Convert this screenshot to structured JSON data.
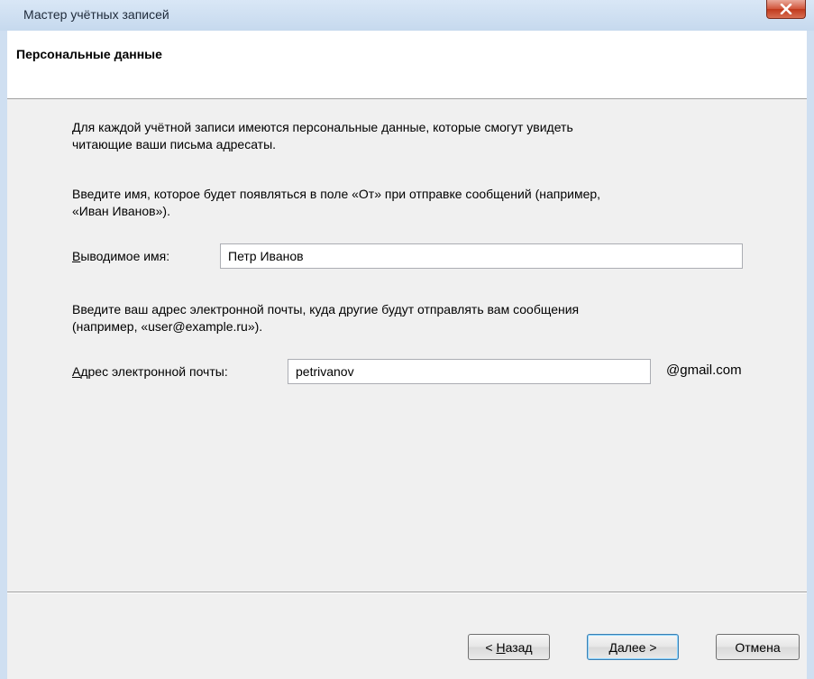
{
  "window": {
    "title": "Мастер учётных записей"
  },
  "header": {
    "title": "Персональные данные"
  },
  "content": {
    "intro_line1": "Для каждой учётной записи имеются персональные данные, которые смогут увидеть",
    "intro_line2": "читающие ваши письма адресаты.",
    "name_hint_line1": "Введите имя, которое будет появляться в поле «От» при отправке сообщений (например,",
    "name_hint_line2": "«Иван Иванов»).",
    "name_label_accel": "В",
    "name_label_rest": "ыводимое имя:",
    "name_value": "Петр Иванов",
    "email_hint_line1": "Введите ваш адрес электронной почты, куда другие будут отправлять вам сообщения",
    "email_hint_line2": "(например, «user@example.ru»).",
    "email_label_accel": "А",
    "email_label_rest": "дрес электронной почты:",
    "email_value": "petrivanov",
    "email_suffix": "@gmail.com"
  },
  "buttons": {
    "back_prefix": "< ",
    "back_accel": "Н",
    "back_rest": "азад",
    "next_accel": "Д",
    "next_rest": "алее >",
    "cancel": "Отмена"
  },
  "icons": {
    "close": "close-icon"
  },
  "colors": {
    "titlebar": "#c6d9ee",
    "close_button": "#c0391c",
    "dialog_bg": "#f0f0f0",
    "header_bg": "#ffffff"
  }
}
